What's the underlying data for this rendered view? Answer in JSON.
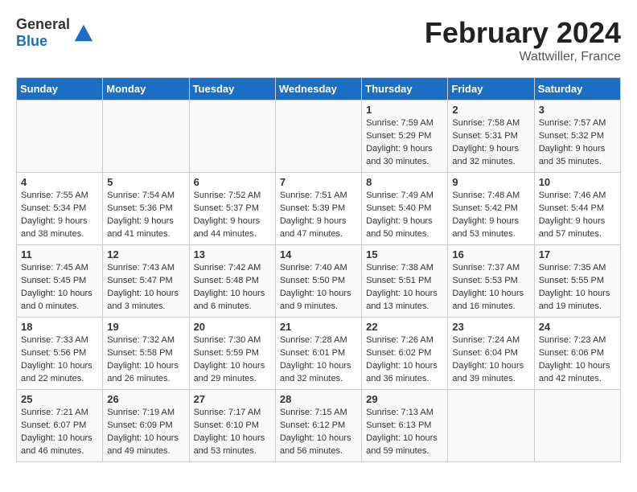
{
  "header": {
    "logo_general": "General",
    "logo_blue": "Blue",
    "month": "February 2024",
    "location": "Wattwiller, France"
  },
  "days_of_week": [
    "Sunday",
    "Monday",
    "Tuesday",
    "Wednesday",
    "Thursday",
    "Friday",
    "Saturday"
  ],
  "weeks": [
    [
      {
        "day": "",
        "content": ""
      },
      {
        "day": "",
        "content": ""
      },
      {
        "day": "",
        "content": ""
      },
      {
        "day": "",
        "content": ""
      },
      {
        "day": "1",
        "content": "Sunrise: 7:59 AM\nSunset: 5:29 PM\nDaylight: 9 hours\nand 30 minutes."
      },
      {
        "day": "2",
        "content": "Sunrise: 7:58 AM\nSunset: 5:31 PM\nDaylight: 9 hours\nand 32 minutes."
      },
      {
        "day": "3",
        "content": "Sunrise: 7:57 AM\nSunset: 5:32 PM\nDaylight: 9 hours\nand 35 minutes."
      }
    ],
    [
      {
        "day": "4",
        "content": "Sunrise: 7:55 AM\nSunset: 5:34 PM\nDaylight: 9 hours\nand 38 minutes."
      },
      {
        "day": "5",
        "content": "Sunrise: 7:54 AM\nSunset: 5:36 PM\nDaylight: 9 hours\nand 41 minutes."
      },
      {
        "day": "6",
        "content": "Sunrise: 7:52 AM\nSunset: 5:37 PM\nDaylight: 9 hours\nand 44 minutes."
      },
      {
        "day": "7",
        "content": "Sunrise: 7:51 AM\nSunset: 5:39 PM\nDaylight: 9 hours\nand 47 minutes."
      },
      {
        "day": "8",
        "content": "Sunrise: 7:49 AM\nSunset: 5:40 PM\nDaylight: 9 hours\nand 50 minutes."
      },
      {
        "day": "9",
        "content": "Sunrise: 7:48 AM\nSunset: 5:42 PM\nDaylight: 9 hours\nand 53 minutes."
      },
      {
        "day": "10",
        "content": "Sunrise: 7:46 AM\nSunset: 5:44 PM\nDaylight: 9 hours\nand 57 minutes."
      }
    ],
    [
      {
        "day": "11",
        "content": "Sunrise: 7:45 AM\nSunset: 5:45 PM\nDaylight: 10 hours\nand 0 minutes."
      },
      {
        "day": "12",
        "content": "Sunrise: 7:43 AM\nSunset: 5:47 PM\nDaylight: 10 hours\nand 3 minutes."
      },
      {
        "day": "13",
        "content": "Sunrise: 7:42 AM\nSunset: 5:48 PM\nDaylight: 10 hours\nand 6 minutes."
      },
      {
        "day": "14",
        "content": "Sunrise: 7:40 AM\nSunset: 5:50 PM\nDaylight: 10 hours\nand 9 minutes."
      },
      {
        "day": "15",
        "content": "Sunrise: 7:38 AM\nSunset: 5:51 PM\nDaylight: 10 hours\nand 13 minutes."
      },
      {
        "day": "16",
        "content": "Sunrise: 7:37 AM\nSunset: 5:53 PM\nDaylight: 10 hours\nand 16 minutes."
      },
      {
        "day": "17",
        "content": "Sunrise: 7:35 AM\nSunset: 5:55 PM\nDaylight: 10 hours\nand 19 minutes."
      }
    ],
    [
      {
        "day": "18",
        "content": "Sunrise: 7:33 AM\nSunset: 5:56 PM\nDaylight: 10 hours\nand 22 minutes."
      },
      {
        "day": "19",
        "content": "Sunrise: 7:32 AM\nSunset: 5:58 PM\nDaylight: 10 hours\nand 26 minutes."
      },
      {
        "day": "20",
        "content": "Sunrise: 7:30 AM\nSunset: 5:59 PM\nDaylight: 10 hours\nand 29 minutes."
      },
      {
        "day": "21",
        "content": "Sunrise: 7:28 AM\nSunset: 6:01 PM\nDaylight: 10 hours\nand 32 minutes."
      },
      {
        "day": "22",
        "content": "Sunrise: 7:26 AM\nSunset: 6:02 PM\nDaylight: 10 hours\nand 36 minutes."
      },
      {
        "day": "23",
        "content": "Sunrise: 7:24 AM\nSunset: 6:04 PM\nDaylight: 10 hours\nand 39 minutes."
      },
      {
        "day": "24",
        "content": "Sunrise: 7:23 AM\nSunset: 6:06 PM\nDaylight: 10 hours\nand 42 minutes."
      }
    ],
    [
      {
        "day": "25",
        "content": "Sunrise: 7:21 AM\nSunset: 6:07 PM\nDaylight: 10 hours\nand 46 minutes."
      },
      {
        "day": "26",
        "content": "Sunrise: 7:19 AM\nSunset: 6:09 PM\nDaylight: 10 hours\nand 49 minutes."
      },
      {
        "day": "27",
        "content": "Sunrise: 7:17 AM\nSunset: 6:10 PM\nDaylight: 10 hours\nand 53 minutes."
      },
      {
        "day": "28",
        "content": "Sunrise: 7:15 AM\nSunset: 6:12 PM\nDaylight: 10 hours\nand 56 minutes."
      },
      {
        "day": "29",
        "content": "Sunrise: 7:13 AM\nSunset: 6:13 PM\nDaylight: 10 hours\nand 59 minutes."
      },
      {
        "day": "",
        "content": ""
      },
      {
        "day": "",
        "content": ""
      }
    ]
  ]
}
